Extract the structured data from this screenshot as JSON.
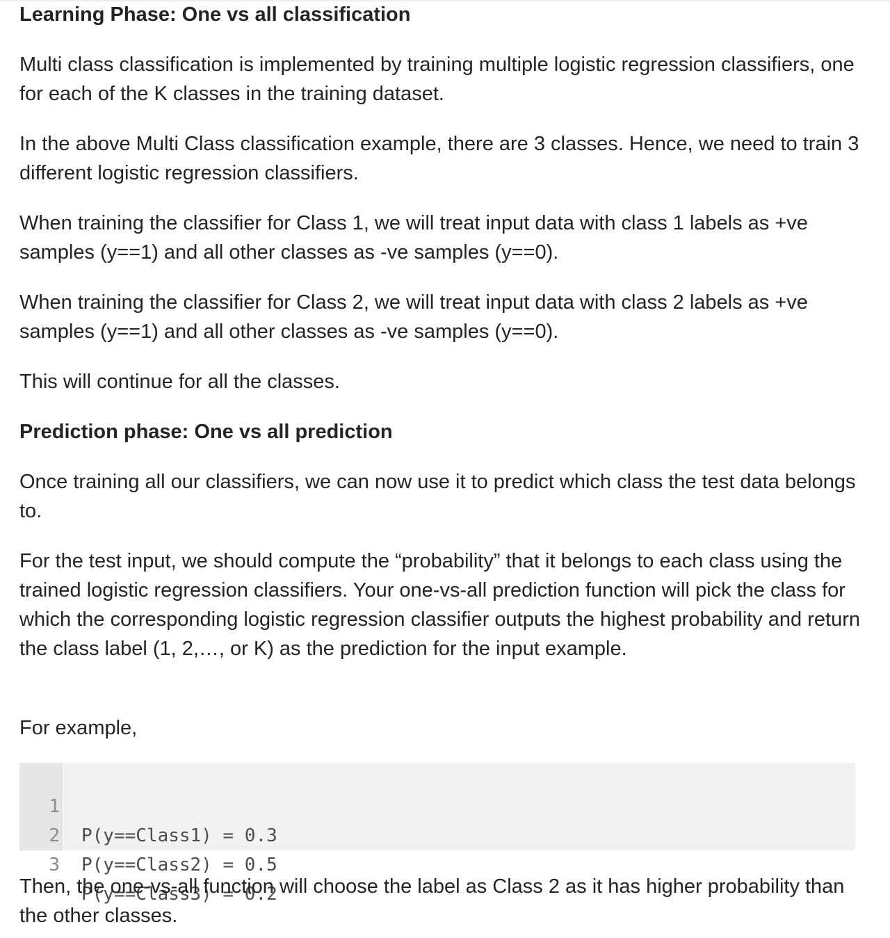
{
  "article": {
    "heading_learning": "Learning Phase: One vs all classification",
    "p1": "Multi class classification is implemented by training multiple logistic regression classifiers, one for each of the K classes in the training dataset.",
    "p2": "In the above Multi Class classification example, there are 3 classes. Hence, we need to train 3 different logistic regression classifiers.",
    "p3": "When training the classifier for Class 1, we will treat input data with class 1 labels as +ve samples (y==1) and all other classes as -ve samples (y==0).",
    "p4": "When training the classifier for Class 2, we will treat input data with class 2 labels as +ve samples (y==1) and all other classes as -ve samples (y==0).",
    "p5": "This will continue for all the classes.",
    "heading_prediction": "Prediction phase: One vs all prediction",
    "p6": "Once training all our classifiers, we can now use it to predict which class the test data belongs to.",
    "p7": "For the test input, we should compute the “probability” that it belongs to each class using the trained logistic regression classifiers. Your one-vs-all prediction function will pick the class for which the corresponding logistic regression classifier outputs the highest probability and return the class label (1, 2,…, or K) as the prediction for the input example.",
    "p8": "For example,",
    "code_lines": [
      {
        "num": "1",
        "code": "P(y==Class1) = 0.3"
      },
      {
        "num": "2",
        "code": "P(y==Class2) = 0.5"
      },
      {
        "num": "3",
        "code": "P(y==Class3) = 0.2"
      }
    ],
    "p9": "Then, the one-vs-all function will choose the label as Class 2 as it has higher probability than the other classes."
  }
}
